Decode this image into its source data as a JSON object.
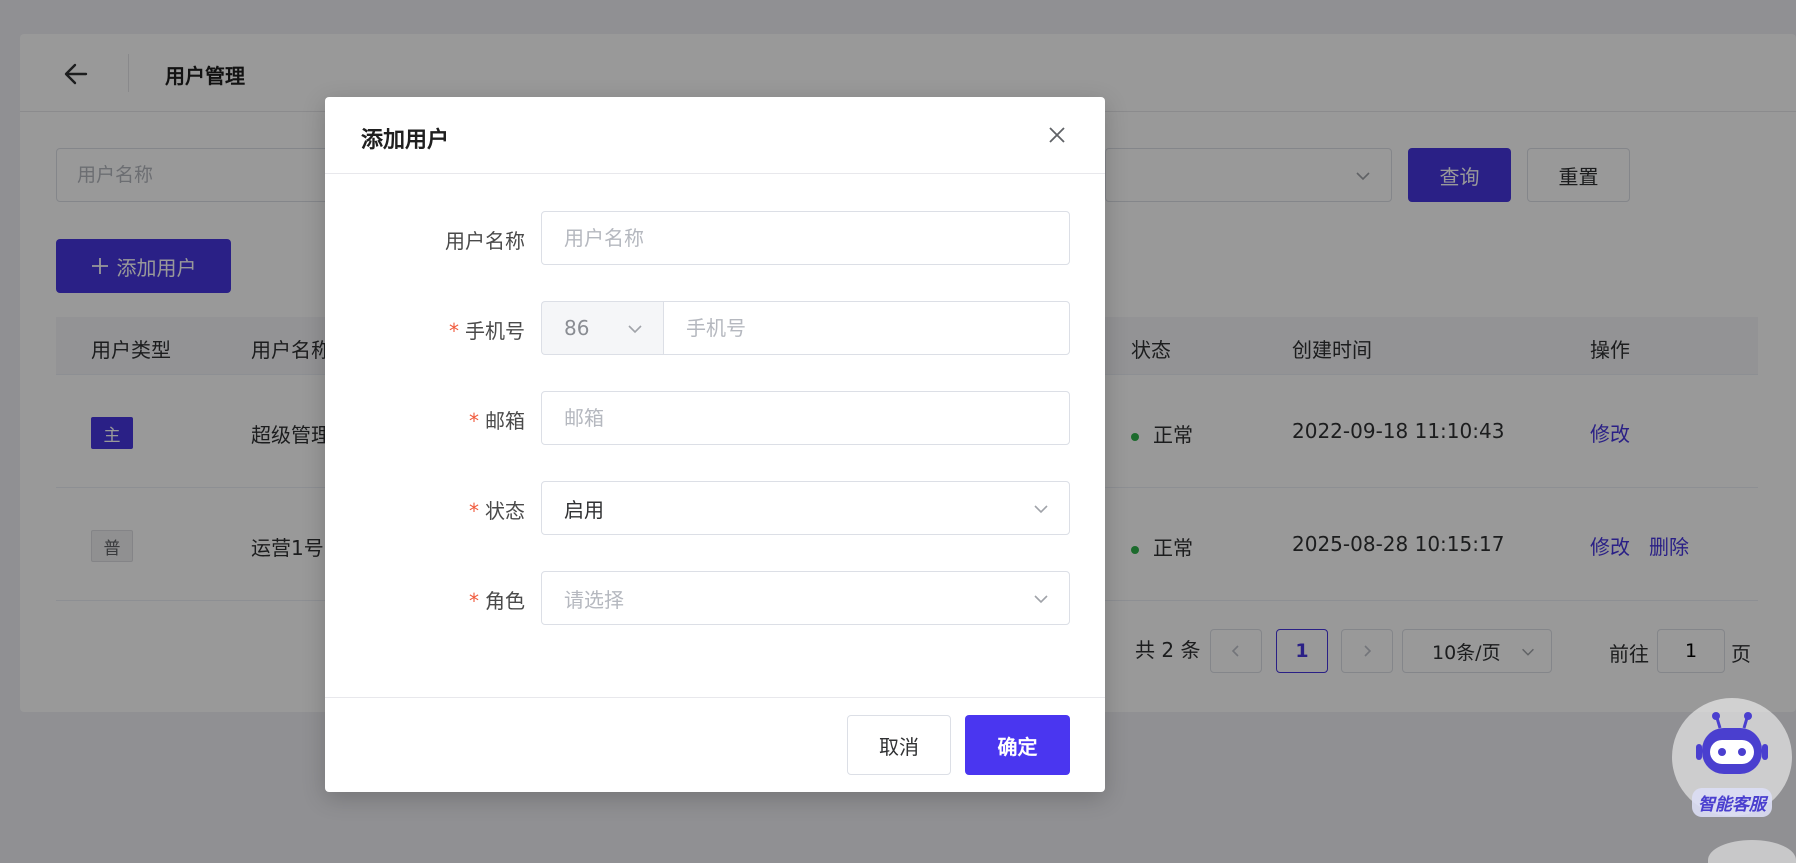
{
  "page": {
    "title": "用户管理",
    "filters": {
      "username_placeholder": "用户名称",
      "query_label": "查询",
      "reset_label": "重置"
    },
    "add_button_label": "添加用户",
    "table": {
      "columns": [
        "用户类型",
        "用户名称",
        "状态",
        "创建时间",
        "操作"
      ],
      "rows": [
        {
          "type": "主",
          "name": "超级管理",
          "status": "正常",
          "created": "2022-09-18 11:10:43",
          "actions": [
            "修改"
          ]
        },
        {
          "type": "普",
          "name": "运营1号",
          "status": "正常",
          "created": "2025-08-28 10:15:17",
          "actions": [
            "修改",
            "删除"
          ]
        }
      ]
    },
    "pagination": {
      "total": "共 2 条",
      "current": "1",
      "page_size": "10条/页",
      "goto_prefix": "前往",
      "goto_value": "1",
      "goto_suffix": "页"
    }
  },
  "dialog": {
    "title": "添加用户",
    "fields": {
      "username": {
        "label": "用户名称",
        "placeholder": "用户名称"
      },
      "phone": {
        "label": "手机号",
        "prefix": "86",
        "placeholder": "手机号"
      },
      "email": {
        "label": "邮箱",
        "placeholder": "邮箱"
      },
      "status": {
        "label": "状态",
        "value": "启用"
      },
      "role": {
        "label": "角色",
        "placeholder": "请选择"
      }
    },
    "cancel_label": "取消",
    "ok_label": "确定"
  },
  "assistant": {
    "label": "智能客服"
  },
  "colors": {
    "primary": "#4636e0",
    "success": "#2fb34c",
    "required": "#f05a3c"
  }
}
